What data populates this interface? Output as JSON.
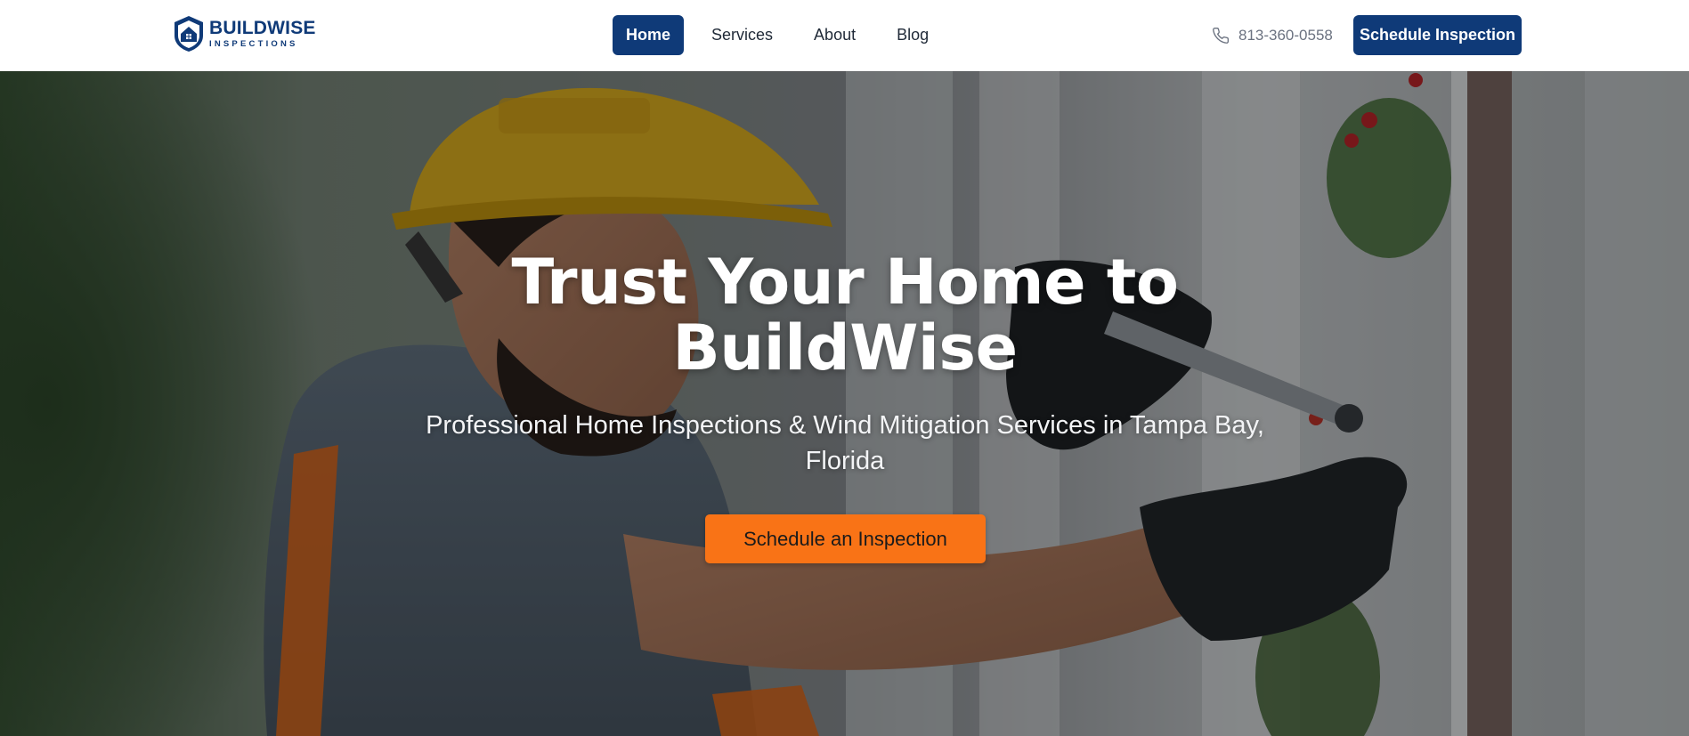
{
  "brand": {
    "name": "BUILDWISE",
    "tagline": "INSPECTIONS",
    "color": "#0f3a78"
  },
  "nav": {
    "items": [
      {
        "label": "Home",
        "active": true
      },
      {
        "label": "Services",
        "active": false
      },
      {
        "label": "About",
        "active": false
      },
      {
        "label": "Blog",
        "active": false
      }
    ]
  },
  "header": {
    "phone": "813-360-0558",
    "phone_icon": "phone-icon",
    "cta_label": "Schedule Inspection"
  },
  "hero": {
    "title_line1": "Trust Your Home to",
    "title_line2": "BuildWise",
    "subtitle": "Professional Home Inspections & Wind Mitigation Services in Tampa Bay, Florida",
    "cta_label": "Schedule an Inspection",
    "cta_color": "#f97316",
    "image_subject": "home inspector in hard hat inspecting exterior"
  }
}
